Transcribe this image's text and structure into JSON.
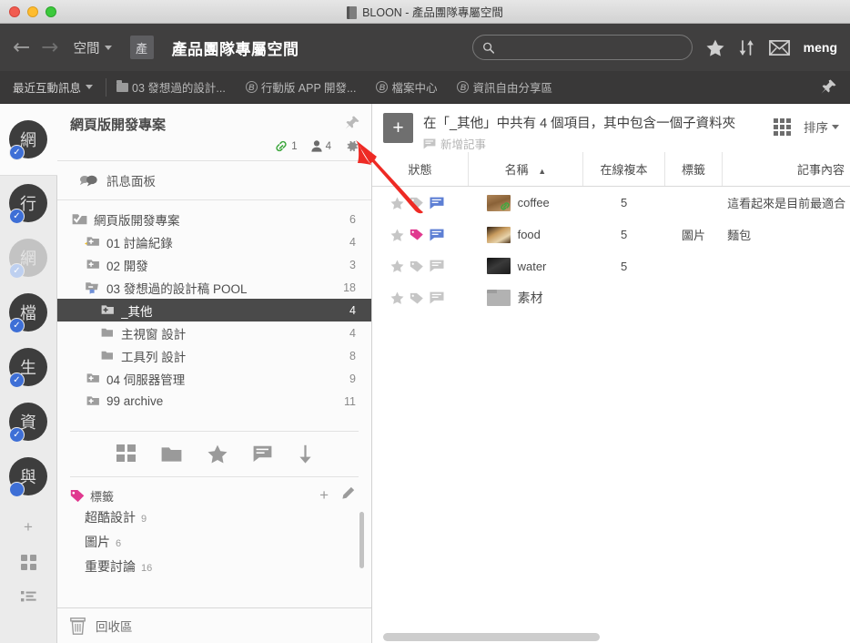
{
  "window": {
    "title": "BLOON - 產品團隊專屬空間",
    "app_icon": "book-icon"
  },
  "navbar": {
    "back_icon": "arrow-left-icon",
    "forward_icon": "arrow-right-icon",
    "space_dropdown_label": "空間",
    "space_badge": "產",
    "space_title": "產品團隊專屬空間",
    "search": {
      "value": "",
      "placeholder": ""
    },
    "star_icon": "star-icon",
    "sort_icon": "sort-updown-icon",
    "mail_icon": "envelope-icon",
    "user": "meng"
  },
  "tabstrip": {
    "recent_label": "最近互動訊息",
    "tabs": [
      {
        "label": "03 發想過的設計...",
        "icon": "folder-icon"
      },
      {
        "label": "行動版 APP 開發...",
        "icon": "b-circle-icon"
      },
      {
        "label": "檔案中心",
        "icon": "b-circle-icon"
      },
      {
        "label": "資訊自由分享區",
        "icon": "b-circle-icon"
      }
    ],
    "pin_icon": "pin-icon"
  },
  "rail": {
    "items": [
      {
        "label": "網",
        "state": "active",
        "badge": "check"
      },
      {
        "label": "行",
        "state": "normal",
        "badge": "check"
      },
      {
        "label": "網",
        "state": "dim",
        "badge": "check-light"
      },
      {
        "label": "檔",
        "state": "normal",
        "badge": "check"
      },
      {
        "label": "生",
        "state": "normal",
        "badge": "check"
      },
      {
        "label": "資",
        "state": "normal",
        "badge": "check"
      },
      {
        "label": "與",
        "state": "normal",
        "badge": "dot"
      }
    ],
    "add_icon": "plus-icon",
    "grid_icon": "four-dots-icon",
    "list_icon": "list-icon"
  },
  "left_panel": {
    "title": "網頁版開發專案",
    "pin_icon": "pin-icon",
    "link_icon": "link-icon",
    "link_count": "1",
    "member_icon": "person-icon",
    "member_count": "4",
    "settings_icon": "gear-icon",
    "message_panel": {
      "label": "訊息面板",
      "icon": "speech-bubbles-icon"
    },
    "tree": [
      {
        "label": "網頁版開發專案",
        "count": "6",
        "indent": 0,
        "icon": "folder-check-icon",
        "selected": false,
        "star": false
      },
      {
        "label": "01 討論紀錄",
        "count": "4",
        "indent": 1,
        "icon": "folder-plus-icon",
        "selected": false,
        "star": true
      },
      {
        "label": "02 開發",
        "count": "3",
        "indent": 1,
        "icon": "folder-plus-icon",
        "selected": false,
        "star": false
      },
      {
        "label": "03 發想過的設計稿 POOL",
        "count": "18",
        "indent": 1,
        "icon": "folder-open-icon",
        "selected": false,
        "star": false
      },
      {
        "label": "_其他",
        "count": "4",
        "indent": 2,
        "icon": "folder-plus-icon",
        "selected": true,
        "star": false
      },
      {
        "label": "主視窗 設計",
        "count": "4",
        "indent": 2,
        "icon": "folder-solid-icon",
        "selected": false,
        "star": false
      },
      {
        "label": "工具列 設計",
        "count": "8",
        "indent": 2,
        "icon": "folder-solid-icon",
        "selected": false,
        "star": false
      },
      {
        "label": "04 伺服器管理",
        "count": "9",
        "indent": 1,
        "icon": "folder-plus-icon",
        "selected": false,
        "star": false
      },
      {
        "label": "99 archive",
        "count": "11",
        "indent": 1,
        "icon": "folder-plus-icon",
        "selected": false,
        "star": false
      }
    ],
    "mini_toolbar": [
      {
        "icon": "grid-squares-icon"
      },
      {
        "icon": "folder-icon"
      },
      {
        "icon": "star-icon"
      },
      {
        "icon": "note-icon"
      },
      {
        "icon": "download-arrow-icon"
      }
    ],
    "tags_header": {
      "label": "標籤",
      "icon": "tag-icon",
      "add_icon": "plus-icon",
      "edit_icon": "pencil-icon"
    },
    "tags": [
      {
        "label": "超酷設計",
        "count": "9"
      },
      {
        "label": "圖片",
        "count": "6"
      },
      {
        "label": "重要討論",
        "count": "16"
      }
    ],
    "trash": {
      "label": "回收區",
      "icon": "trash-icon"
    }
  },
  "right_panel": {
    "add_button": "+",
    "summary": "在「_其他」中共有 4 個項目，其中包含一個子資料夾",
    "add_note_label": "新增記事",
    "add_note_icon": "note-icon",
    "grid_icon": "nine-dots-icon",
    "sort_label": "排序",
    "columns": [
      "狀態",
      "名稱",
      "在線複本",
      "標籤",
      "記事內容"
    ],
    "sort_column": "名稱",
    "sort_direction": "ascending",
    "rows": [
      {
        "name": "coffee",
        "copies": "5",
        "tag": "",
        "note": "這看起來是目前最適合",
        "thumb": "th-coffee",
        "star": "off",
        "label_color": "off",
        "note_flag": "on",
        "link_overlay": true
      },
      {
        "name": "food",
        "copies": "5",
        "tag": "圖片",
        "note": "麵包",
        "thumb": "th-food",
        "star": "off",
        "label_color": "pink",
        "note_flag": "on",
        "link_overlay": false
      },
      {
        "name": "water",
        "copies": "5",
        "tag": "",
        "note": "",
        "thumb": "th-water",
        "star": "off",
        "label_color": "off",
        "note_flag": "off",
        "link_overlay": false
      },
      {
        "name": "素材",
        "copies": "",
        "tag": "",
        "note": "",
        "thumb": "th-folder",
        "star": "off",
        "label_color": "off",
        "note_flag": "off",
        "link_overlay": false
      }
    ]
  },
  "annotation": {
    "type": "red-arrow",
    "points_to": "gear-icon"
  },
  "colors": {
    "navbar_bg": "#403f3f",
    "tabstrip_bg": "#393838",
    "selection_bg": "#4a4a4a",
    "accent_blue": "#3e6fd6",
    "tag_pink": "#e0398f",
    "annotation_red": "#ee2a24",
    "link_green": "#3fa83f"
  }
}
